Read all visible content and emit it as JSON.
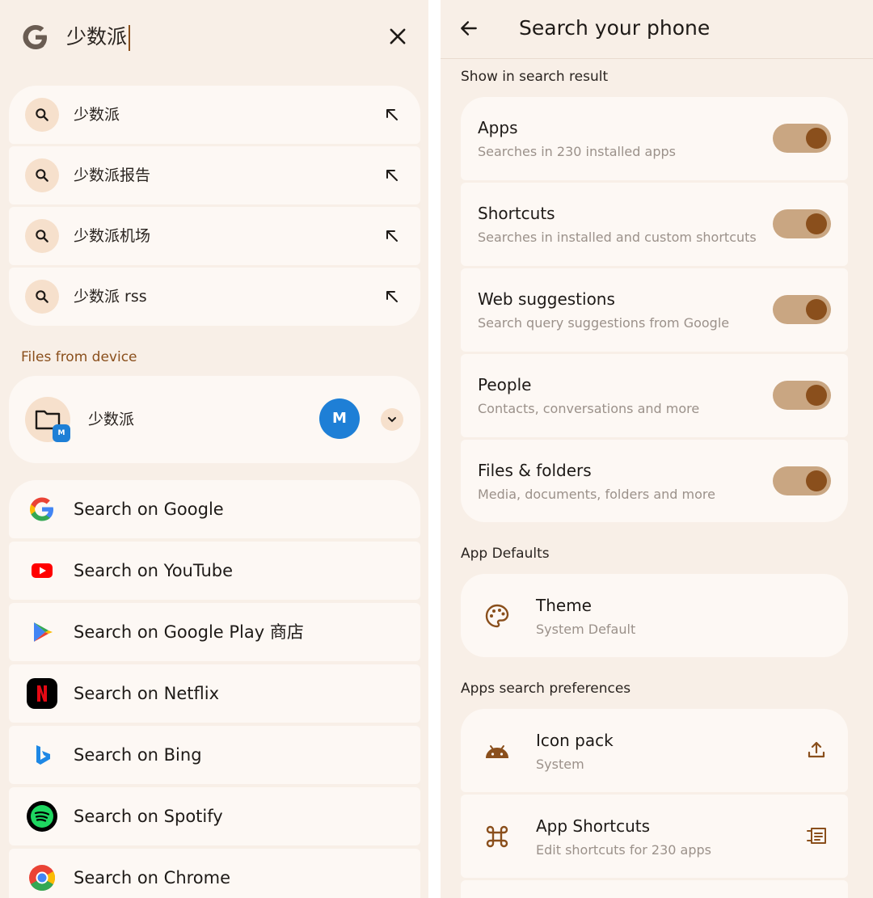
{
  "left": {
    "query": "少数派",
    "suggestions": [
      {
        "text": "少数派"
      },
      {
        "text": "少数派报告"
      },
      {
        "text": "少数派机场"
      },
      {
        "text": "少数派 rss"
      }
    ],
    "files_section": "Files from device",
    "file": {
      "name": "少数派",
      "app_badge": "M",
      "app_icon_text": "M"
    },
    "search_providers": [
      {
        "label": "Search on Google",
        "icon": "google-icon"
      },
      {
        "label": "Search on YouTube",
        "icon": "youtube-icon"
      },
      {
        "label": "Search on Google Play 商店",
        "icon": "google-play-icon"
      },
      {
        "label": "Search on Netflix",
        "icon": "netflix-icon"
      },
      {
        "label": "Search on Bing",
        "icon": "bing-icon"
      },
      {
        "label": "Search on Spotify",
        "icon": "spotify-icon"
      },
      {
        "label": "Search on Chrome",
        "icon": "chrome-icon"
      }
    ]
  },
  "right": {
    "title": "Search your phone",
    "show_section": "Show in search result",
    "toggles": [
      {
        "title": "Apps",
        "subtitle": "Searches in 230 installed apps",
        "on": true
      },
      {
        "title": "Shortcuts",
        "subtitle": "Searches in installed and custom shortcuts",
        "on": true
      },
      {
        "title": "Web suggestions",
        "subtitle": "Search query suggestions from Google",
        "on": true
      },
      {
        "title": "People",
        "subtitle": "Contacts, conversations and more",
        "on": true
      },
      {
        "title": "Files & folders",
        "subtitle": "Media, documents, folders and more",
        "on": true
      }
    ],
    "defaults_section": "App Defaults",
    "theme": {
      "title": "Theme",
      "subtitle": "System Default"
    },
    "prefs_section": "Apps search preferences",
    "prefs": [
      {
        "title": "Icon pack",
        "subtitle": "System",
        "icon": "android-icon",
        "action_icon": "upload-icon"
      },
      {
        "title": "App Shortcuts",
        "subtitle": "Edit shortcuts for 230 apps",
        "icon": "command-icon",
        "action_icon": "edit-list-icon"
      }
    ]
  },
  "colors": {
    "background": "#f8efe7",
    "card": "#fdf8f4",
    "accent": "#8a4f1c",
    "toggle_track": "#c9a682",
    "icon_chip": "#f6e0cc"
  }
}
